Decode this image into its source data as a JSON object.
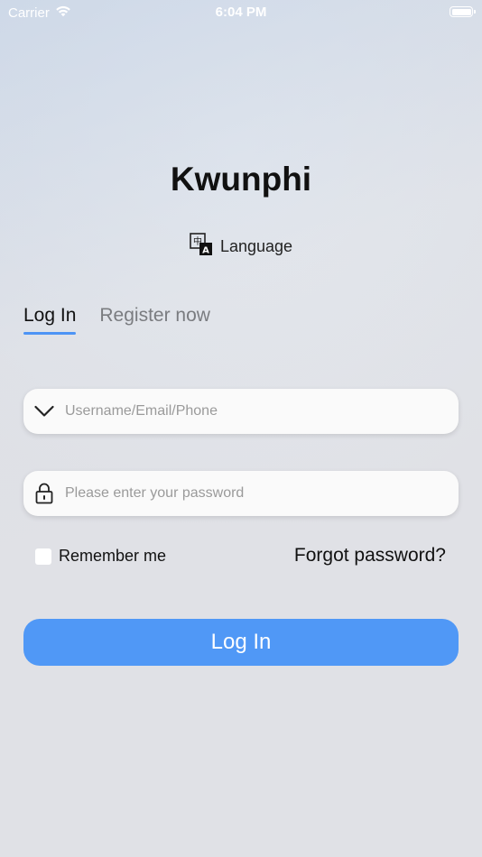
{
  "status_bar": {
    "carrier": "Carrier",
    "time": "6:04 PM"
  },
  "app": {
    "title": "Kwunphi"
  },
  "language": {
    "label": "Language",
    "icon": "translate-icon"
  },
  "tabs": [
    {
      "label": "Log In",
      "active": true
    },
    {
      "label": "Register now",
      "active": false
    }
  ],
  "form": {
    "username": {
      "value": "",
      "placeholder": "Username/Email/Phone",
      "icon": "chevron-down-icon"
    },
    "password": {
      "value": "",
      "placeholder": "Please enter your password",
      "icon": "lock-icon"
    },
    "remember_label": "Remember me",
    "remember_checked": false,
    "forgot_label": "Forgot password?",
    "submit_label": "Log In"
  },
  "colors": {
    "accent": "#5098f6",
    "tab_underline": "#4d94f5"
  }
}
